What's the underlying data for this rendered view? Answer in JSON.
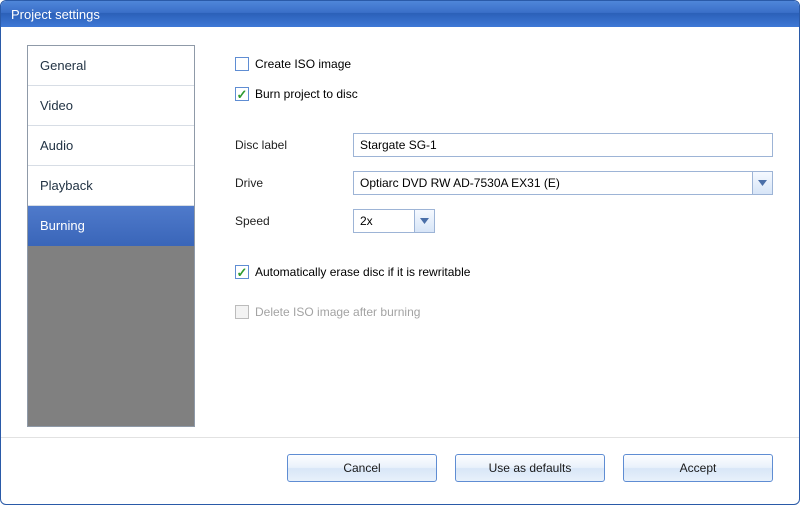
{
  "window": {
    "title": "Project settings"
  },
  "sidebar": {
    "items": [
      {
        "label": "General"
      },
      {
        "label": "Video"
      },
      {
        "label": "Audio"
      },
      {
        "label": "Playback"
      },
      {
        "label": "Burning"
      }
    ],
    "selected_index": 4
  },
  "burning": {
    "create_iso": {
      "label": "Create ISO image",
      "checked": false
    },
    "burn_project": {
      "label": "Burn project to disc",
      "checked": true
    },
    "disc_label_label": "Disc label",
    "disc_label_value": "Stargate SG-1",
    "drive_label": "Drive",
    "drive_value": "Optiarc DVD RW AD-7530A EX31 (E)",
    "speed_label": "Speed",
    "speed_value": "2x",
    "auto_erase": {
      "label": "Automatically erase disc if it is rewritable",
      "checked": true
    },
    "delete_iso": {
      "label": "Delete ISO image after burning",
      "checked": false,
      "disabled": true
    }
  },
  "buttons": {
    "cancel": "Cancel",
    "use_defaults": "Use as defaults",
    "accept": "Accept"
  },
  "glyphs": {
    "check": "✓"
  }
}
